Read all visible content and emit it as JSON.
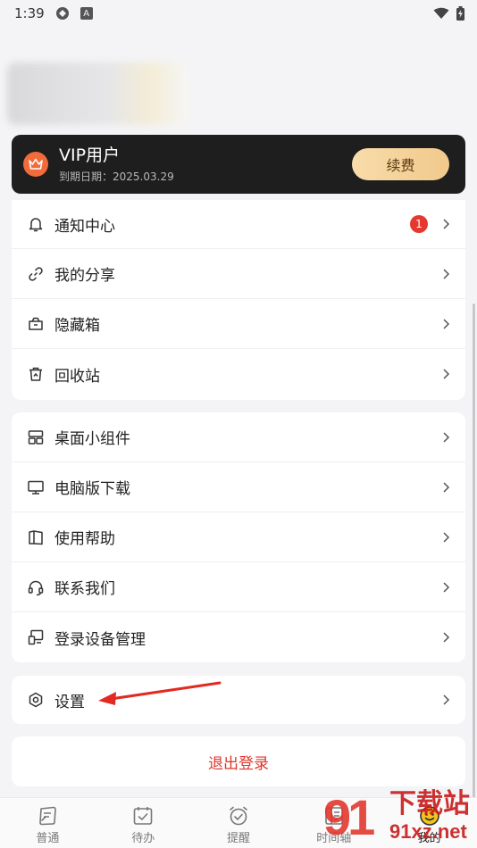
{
  "status_bar": {
    "time": "1:39",
    "notif_a_label": "A"
  },
  "vip": {
    "title": "VIP用户",
    "expire": "到期日期：2025.03.29",
    "renew_label": "续费"
  },
  "menu_group_1": [
    {
      "label": "通知中心",
      "badge": "1"
    },
    {
      "label": "我的分享"
    },
    {
      "label": "隐藏箱"
    },
    {
      "label": "回收站"
    }
  ],
  "menu_group_2": [
    {
      "label": "桌面小组件"
    },
    {
      "label": "电脑版下载"
    },
    {
      "label": "使用帮助"
    },
    {
      "label": "联系我们"
    },
    {
      "label": "登录设备管理"
    }
  ],
  "menu_group_3": [
    {
      "label": "设置"
    }
  ],
  "logout_label": "退出登录",
  "tabs": [
    {
      "label": "普通",
      "icon": "note-icon"
    },
    {
      "label": "待办",
      "icon": "calendar-check-icon"
    },
    {
      "label": "提醒",
      "icon": "alarm-check-icon"
    },
    {
      "label": "时间轴",
      "icon": "timeline-icon"
    },
    {
      "label": "我的",
      "icon": "profile-icon",
      "active": true
    }
  ],
  "watermark": {
    "num": "91",
    "cn": "下载站",
    "domain": "91xz.net"
  },
  "colors": {
    "accent_red": "#e0362c",
    "vip_bg": "#1e1e1e",
    "renew_gold": "#f1c98b",
    "crown_orange": "#f26b3a"
  }
}
